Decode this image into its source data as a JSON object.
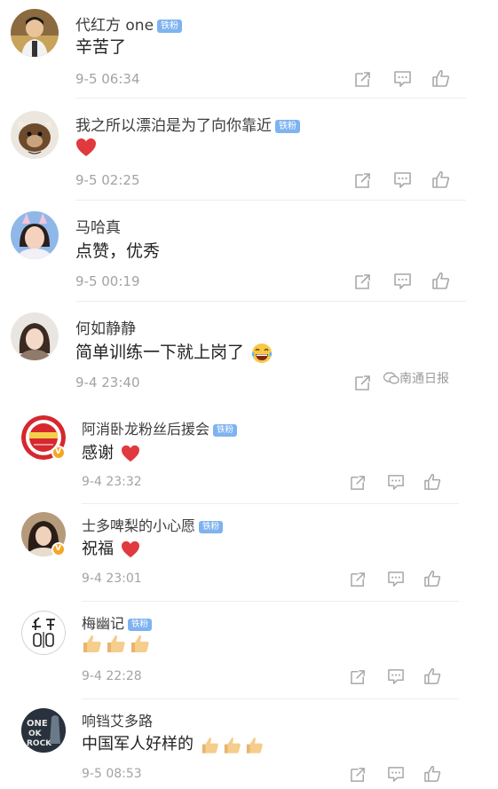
{
  "comments": [
    {
      "user": "代红方 one",
      "badge": "铁粉",
      "text": "辛苦了",
      "time": "9-5 06:34"
    },
    {
      "user": "我之所以漂泊是为了向你靠近",
      "badge": "铁粉",
      "text": "",
      "time": "9-5 02:25"
    },
    {
      "user": "马哈真",
      "badge": "",
      "text": "点赞，优秀",
      "time": "9-5 00:19"
    },
    {
      "user": "何如静静",
      "badge": "",
      "text": "简单训练一下就上岗了",
      "time": "9-4 23:40"
    },
    {
      "user": "阿消卧龙粉丝后援会",
      "badge": "铁粉",
      "text": "感谢",
      "time": "9-4 23:32"
    },
    {
      "user": "士多啤梨的小心愿",
      "badge": "铁粉",
      "text": "祝福",
      "time": "9-4 23:01"
    },
    {
      "user": "梅幽记",
      "badge": "铁粉",
      "text": "",
      "time": "9-4 22:28"
    },
    {
      "user": "响铛艾多路",
      "badge": "",
      "text": "中国军人好样的",
      "time": "9-5 08:53"
    }
  ],
  "emoji": {
    "heart": "red-heart",
    "laugh": "laughing-tears-face",
    "thumbs_up": "thumbs-up"
  },
  "actions": [
    "share-icon",
    "comment-icon",
    "like-icon"
  ],
  "watermark": "南通日报",
  "colors": {
    "badge": "#7eb3f0",
    "time": "#a3a3a3",
    "heart": "#e0393e",
    "verified": "#f5a623",
    "divider": "#ededed"
  }
}
